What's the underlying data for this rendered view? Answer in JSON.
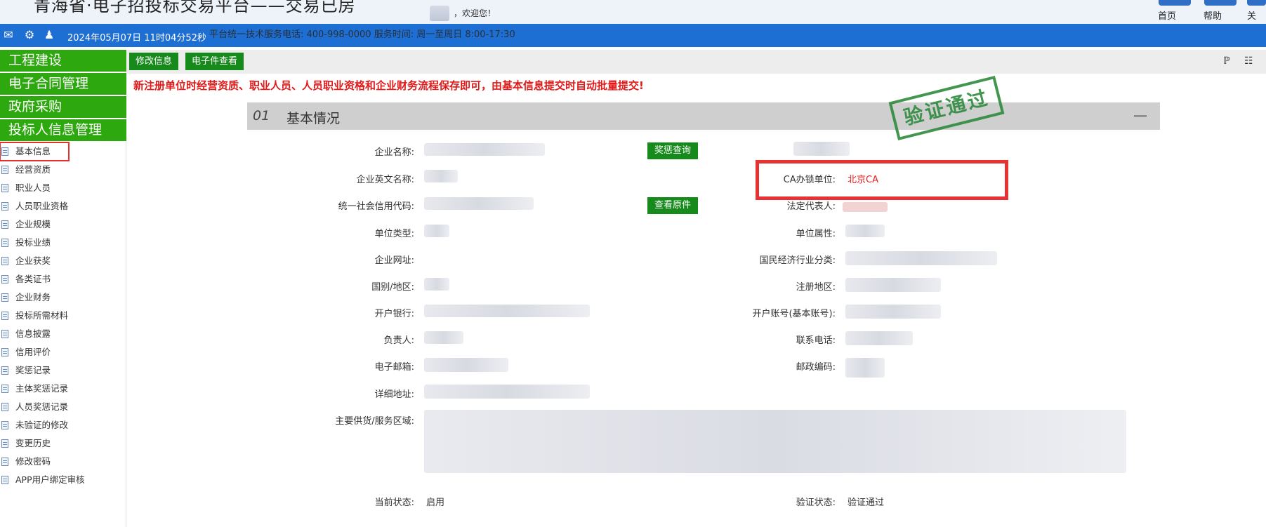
{
  "header": {
    "site_title": "青海省·电子招投标交易平台——交易已房",
    "welcome": "，欢迎您！",
    "nav": [
      {
        "label": "首页"
      },
      {
        "label": "帮助"
      },
      {
        "label": "关"
      }
    ]
  },
  "bluebar": {
    "datetime": "2024年05月07日 11时04分52秒",
    "service": "平台统一技术服务电话: 400-998-0000 服务时间: 周一至周日 8:00-17:30"
  },
  "sidebar": {
    "main_items": [
      {
        "label": "工程建设"
      },
      {
        "label": "电子合同管理"
      },
      {
        "label": "政府采购"
      },
      {
        "label": "投标人信息管理"
      }
    ],
    "sub_items": [
      {
        "label": "基本信息"
      },
      {
        "label": "经营资质"
      },
      {
        "label": "职业人员"
      },
      {
        "label": "人员职业资格"
      },
      {
        "label": "企业规模"
      },
      {
        "label": "投标业绩"
      },
      {
        "label": "企业获奖"
      },
      {
        "label": "各类证书"
      },
      {
        "label": "企业财务"
      },
      {
        "label": "投标所需材料"
      },
      {
        "label": "信息披露"
      },
      {
        "label": "信用评价"
      },
      {
        "label": "奖惩记录"
      },
      {
        "label": "主体奖惩记录"
      },
      {
        "label": "人员奖惩记录"
      },
      {
        "label": "未验证的修改"
      },
      {
        "label": "变更历史"
      },
      {
        "label": "修改密码"
      },
      {
        "label": "APP用户绑定审核"
      }
    ]
  },
  "toolbar": {
    "edit_label": "修改信息",
    "efile_label": "电子件查看"
  },
  "notice": "新注册单位时经营资质、职业人员、人员职业资格和企业财务流程保存即可，由基本信息提交时自动批量提交!",
  "section": {
    "num": "01",
    "title": "基本情况",
    "collapse": "—",
    "stamp": "验证通过"
  },
  "form": {
    "company_name": "企业名称:",
    "company_en_name": "企业英文名称:",
    "credit_code": "统一社会信用代码:",
    "unit_type": "单位类型:",
    "website": "企业网址:",
    "country": "国别/地区:",
    "bank": "开户银行:",
    "principal": "负责人:",
    "email": "电子邮箱:",
    "address": "详细地址:",
    "supply_area": "主要供货/服务区域:",
    "current_status": "当前状态:",
    "current_status_value": "启用",
    "ca_unit": "CA办锁单位:",
    "ca_unit_value": "北京CA",
    "legal_rep": "法定代表人:",
    "unit_attr": "单位属性:",
    "industry": "国民经济行业分类:",
    "reg_region": "注册地区:",
    "account": "开户账号(基本账号):",
    "phone": "联系电话:",
    "postcode": "邮政编码:",
    "verify_status": "验证状态:",
    "verify_status_value": "验证通过",
    "reward_query": "奖惩查询",
    "view_original": "查看原件"
  }
}
